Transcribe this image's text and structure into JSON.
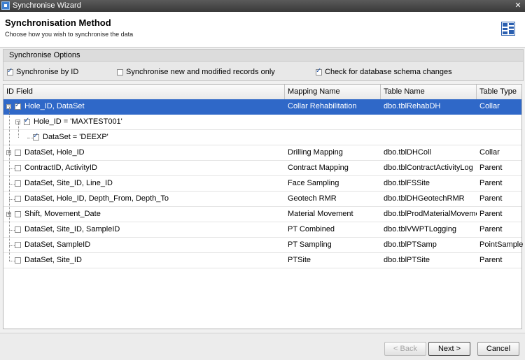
{
  "window": {
    "title": "Synchronise Wizard",
    "close_glyph": "✕"
  },
  "header": {
    "title": "Synchronisation Method",
    "subtitle": "Choose how you wish to synchronise the data",
    "icon": "wizard-grid-icon"
  },
  "options": {
    "group_title": "Synchronise Options",
    "by_id": {
      "label": "Synchronise by ID",
      "checked": true
    },
    "new_modified": {
      "label": "Synchronise new and modified records only",
      "checked": false
    },
    "schema_changes": {
      "label": "Check for database schema changes",
      "checked": true
    }
  },
  "grid": {
    "columns": [
      "ID Field",
      "Mapping Name",
      "Table Name",
      "Table Type"
    ],
    "rows": [
      {
        "id": "Hole_ID, DataSet",
        "mapping": "Collar Rehabilitation",
        "table": "dbo.tblRehabDH",
        "type": "Collar",
        "checked": true,
        "selected": true,
        "level": 0,
        "expander": "−"
      },
      {
        "id": "Hole_ID = 'MAXTEST001'",
        "mapping": "",
        "table": "",
        "type": "",
        "checked": true,
        "selected": false,
        "level": 1,
        "expander": "−"
      },
      {
        "id": "DataSet = 'DEEXP'",
        "mapping": "",
        "table": "",
        "type": "",
        "checked": true,
        "selected": false,
        "level": 2,
        "expander": ""
      },
      {
        "id": "DataSet, Hole_ID",
        "mapping": "Drilling Mapping",
        "table": "dbo.tblDHColl",
        "type": "Collar",
        "checked": false,
        "selected": false,
        "level": 0,
        "expander": "+"
      },
      {
        "id": "ContractID, ActivityID",
        "mapping": "Contract Mapping",
        "table": "dbo.tblContractActivityLog",
        "type": "Parent",
        "checked": false,
        "selected": false,
        "level": 0,
        "expander": ""
      },
      {
        "id": "DataSet, Site_ID, Line_ID",
        "mapping": "Face Sampling",
        "table": "dbo.tblFSSite",
        "type": "Parent",
        "checked": false,
        "selected": false,
        "level": 0,
        "expander": ""
      },
      {
        "id": "DataSet, Hole_ID, Depth_From, Depth_To",
        "mapping": "Geotech RMR",
        "table": "dbo.tblDHGeotechRMR",
        "type": "Parent",
        "checked": false,
        "selected": false,
        "level": 0,
        "expander": ""
      },
      {
        "id": "Shift, Movement_Date",
        "mapping": "Material Movement",
        "table": "dbo.tblProdMaterialMovement",
        "type": "Parent",
        "checked": false,
        "selected": false,
        "level": 0,
        "expander": "+"
      },
      {
        "id": "DataSet, Site_ID, SampleID",
        "mapping": "PT Combined",
        "table": "dbo.tblVWPTLogging",
        "type": "Parent",
        "checked": false,
        "selected": false,
        "level": 0,
        "expander": ""
      },
      {
        "id": "DataSet, SampleID",
        "mapping": "PT Sampling",
        "table": "dbo.tblPTSamp",
        "type": "PointSample",
        "checked": false,
        "selected": false,
        "level": 0,
        "expander": ""
      },
      {
        "id": "DataSet, Site_ID",
        "mapping": "PTSite",
        "table": "dbo.tblPTSite",
        "type": "Parent",
        "checked": false,
        "selected": false,
        "level": 0,
        "expander": ""
      }
    ]
  },
  "footer": {
    "back_label": "< Back",
    "next_label": "Next >",
    "cancel_label": "Cancel"
  },
  "colors": {
    "selection": "#2f68c8",
    "titlebar": "#4a4a4a"
  }
}
